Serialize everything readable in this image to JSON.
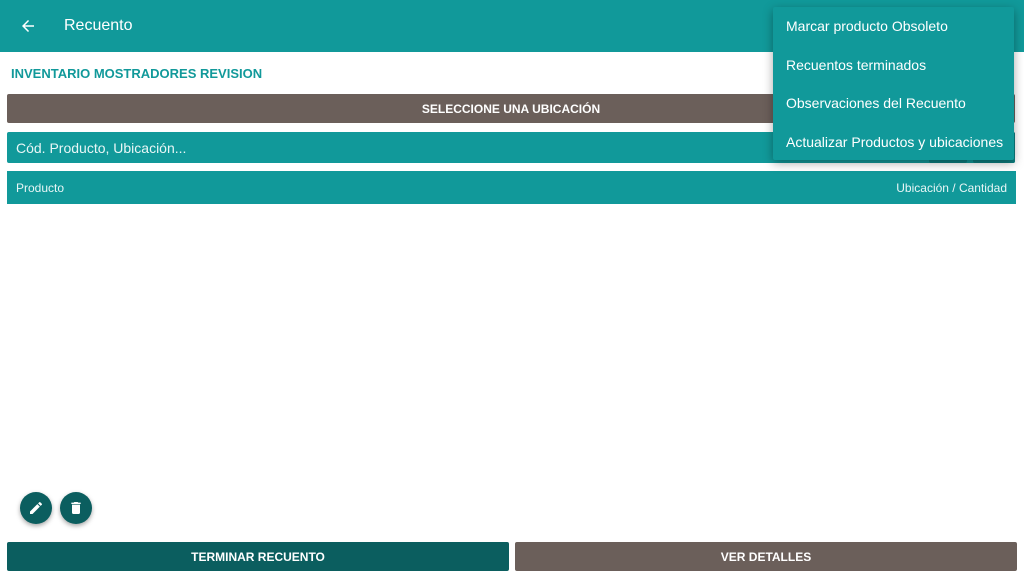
{
  "appbar": {
    "title": "Recuento",
    "back_icon": "arrow-left-icon"
  },
  "inventory": {
    "title": "INVENTARIO MOSTRADORES REVISION"
  },
  "location": {
    "button_label": "SELECCIONE UNA UBICACIÓN"
  },
  "search": {
    "placeholder": "Cód. Producto, Ubicación..."
  },
  "table": {
    "col_product": "Producto",
    "col_location_qty": "Ubicación / Cantidad",
    "rows": []
  },
  "menu": {
    "items": [
      {
        "label": "Marcar producto Obsoleto"
      },
      {
        "label": "Recuentos terminados"
      },
      {
        "label": "Observaciones del Recuento"
      },
      {
        "label": "Actualizar Productos y ubicaciones"
      }
    ]
  },
  "fabs": {
    "edit_icon": "pencil-icon",
    "delete_icon": "trash-icon"
  },
  "footer": {
    "finish_label": "TERMINAR RECUENTO",
    "details_label": "VER DETALLES"
  },
  "colors": {
    "primary": "#11999a",
    "primary_dark": "#0b5e5f",
    "secondary": "#6b5f5a"
  }
}
